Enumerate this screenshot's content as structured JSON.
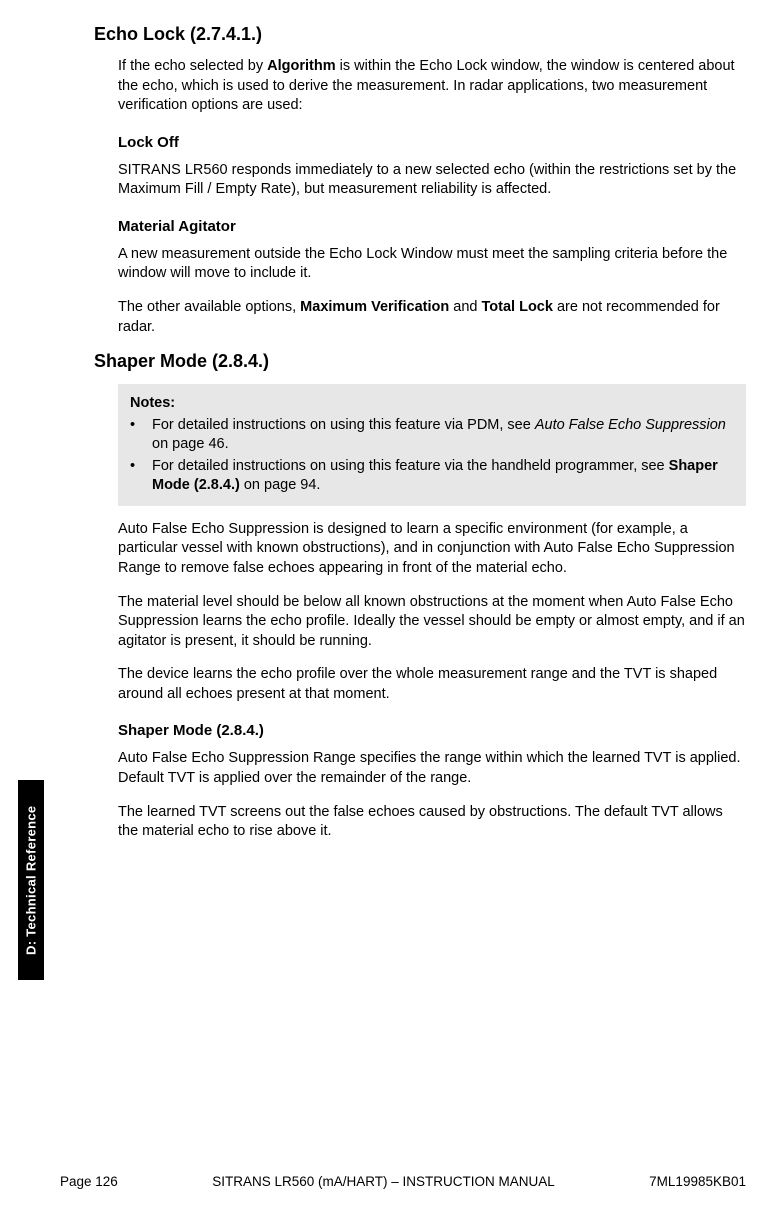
{
  "sidetab": "D: Technical Reference",
  "sections": {
    "echoLock": {
      "heading": "Echo Lock (2.7.4.1.)",
      "intro_pre": "If the echo selected by ",
      "intro_bold": "Algorithm",
      "intro_post": " is within the Echo Lock window, the window is centered about the echo, which is used to derive the measurement. In radar applications, two measurement verification options are used:",
      "lockOff": {
        "heading": "Lock Off",
        "para": "SITRANS LR560 responds immediately to a new selected echo (within the restrictions set by the Maximum Fill / Empty Rate), but measurement reliability is affected."
      },
      "materialAgitator": {
        "heading": "Material Agitator",
        "para1": "A new measurement outside the Echo Lock Window must meet the sampling criteria before the window will move to include it.",
        "para2_pre": "The other available options, ",
        "para2_b1": "Maximum Verification",
        "para2_mid": " and ",
        "para2_b2": "Total Lock",
        "para2_post": " are not recommended for radar."
      }
    },
    "shaperMode": {
      "heading": "Shaper Mode (2.8.4.)",
      "notes": {
        "label": "Notes:",
        "b1_pre": "For detailed instructions on using this feature via PDM, see ",
        "b1_link": "Auto False Echo Suppression",
        "b1_post": " on page 46.",
        "b2_pre": "For detailed instructions on using this feature via the handheld programmer, see ",
        "b2_link": "Shaper Mode (2.8.4.)",
        "b2_post": " on page 94."
      },
      "para1": "Auto False Echo Suppression is designed to learn a specific environment (for example, a particular vessel with known obstructions), and in conjunction with Auto False Echo Suppression Range to remove false echoes appearing in front of the material echo.",
      "para2": "The material level should be below all known obstructions at the moment when Auto False Echo Suppression learns the echo profile. Ideally the vessel should be empty or almost empty, and if an agitator is present, it should be running.",
      "para3": "The device learns the echo profile over the whole measurement range and the TVT is shaped around all echoes present at that moment.",
      "sub": {
        "heading": "Shaper Mode (2.8.4.)",
        "para1": "Auto False Echo Suppression Range specifies the range within which the learned TVT is applied. Default TVT is applied over the remainder of the range.",
        "para2": "The learned TVT screens out the false echoes caused by obstructions. The default TVT allows the material echo to rise above it."
      }
    }
  },
  "footer": {
    "left": "Page 126",
    "center": "SITRANS LR560 (mA/HART) – INSTRUCTION MANUAL",
    "right": "7ML19985KB01"
  }
}
